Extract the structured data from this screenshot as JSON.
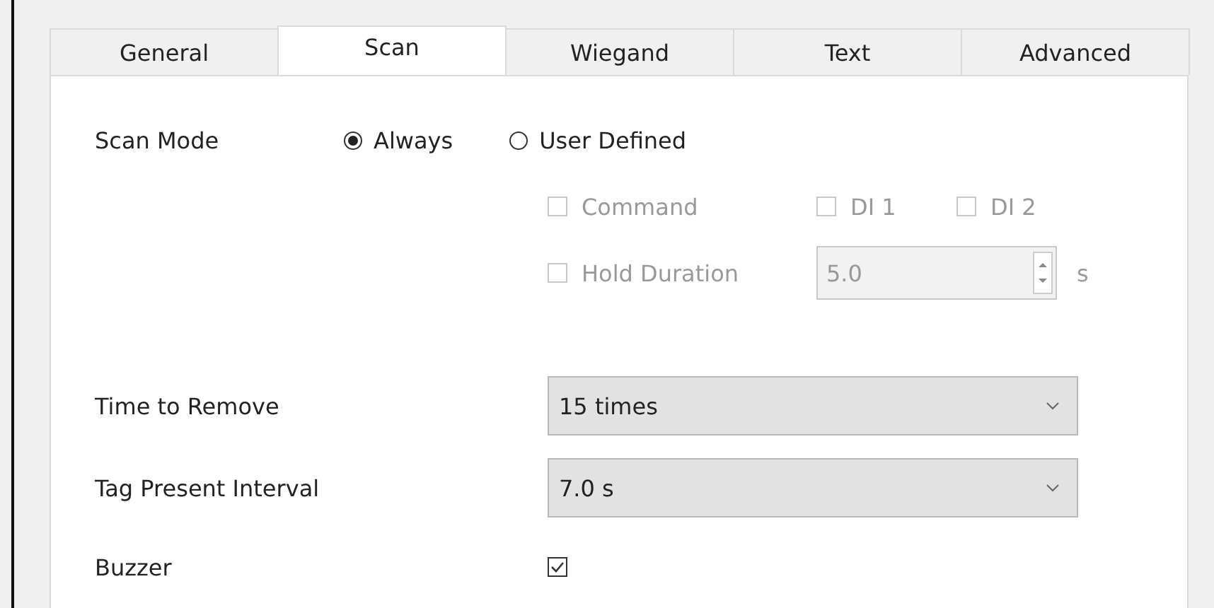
{
  "tabs": [
    {
      "label": "General",
      "selected": false
    },
    {
      "label": "Scan",
      "selected": true
    },
    {
      "label": "Wiegand",
      "selected": false
    },
    {
      "label": "Text",
      "selected": false
    },
    {
      "label": "Advanced",
      "selected": false
    }
  ],
  "scan_mode": {
    "label": "Scan Mode",
    "options": [
      {
        "label": "Always",
        "selected": true
      },
      {
        "label": "User Defined",
        "selected": false
      }
    ],
    "triggers": [
      {
        "label": "Command",
        "checked": false,
        "disabled": true
      },
      {
        "label": "DI 1",
        "checked": false,
        "disabled": true
      },
      {
        "label": "DI 2",
        "checked": false,
        "disabled": true
      }
    ],
    "hold_duration": {
      "label": "Hold Duration",
      "checked": false,
      "disabled": true,
      "value": "5.0",
      "unit": "s"
    }
  },
  "settings": [
    {
      "kind": "dropdown",
      "label": "Time to Remove",
      "value": "15 times"
    },
    {
      "kind": "dropdown",
      "label": "Tag Present Interval",
      "value": "7.0 s"
    },
    {
      "kind": "checkbox",
      "label": "Buzzer",
      "checked": true
    }
  ]
}
